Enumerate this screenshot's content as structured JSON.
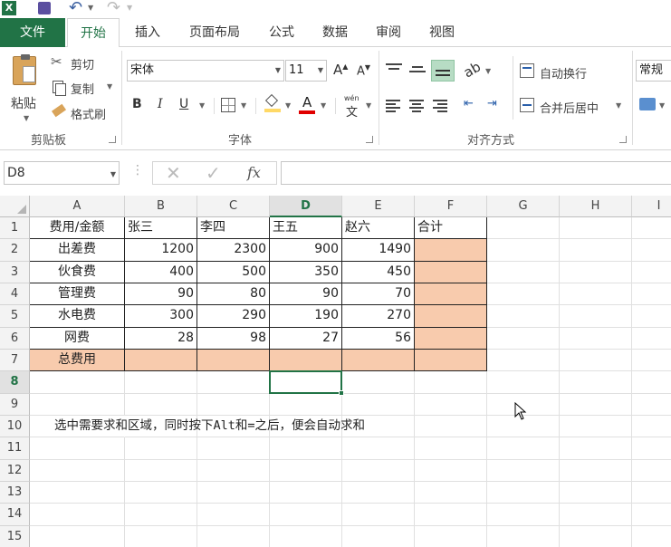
{
  "ribbon_tabs": [
    "文件",
    "开始",
    "插入",
    "页面布局",
    "公式",
    "数据",
    "审阅",
    "视图"
  ],
  "clipboard": {
    "paste": "粘贴",
    "cut": "剪切",
    "copy": "复制",
    "format_painter": "格式刷",
    "group": "剪贴板"
  },
  "font": {
    "name": "宋体",
    "size": "11",
    "group": "字体",
    "bold": "B",
    "italic": "I",
    "underline": "U",
    "font_color_glyph": "A",
    "phonetic": "wén"
  },
  "alignment": {
    "wrap_text": "自动换行",
    "merge_center": "合并后居中",
    "group": "对齐方式"
  },
  "number": {
    "format": "常规"
  },
  "formula_bar": {
    "name_box": "D8",
    "fx": "fx",
    "content": ""
  },
  "columns": [
    "A",
    "B",
    "C",
    "D",
    "E",
    "F",
    "G",
    "H",
    "I"
  ],
  "rows": [
    "1",
    "2",
    "3",
    "4",
    "5",
    "6",
    "7",
    "8",
    "9",
    "10",
    "11",
    "12",
    "13",
    "14",
    "15"
  ],
  "sheet": {
    "headers": [
      "费用/金额",
      "张三",
      "李四",
      "王五",
      "赵六",
      "合计"
    ],
    "data": [
      [
        "出差费",
        "1200",
        "2300",
        "900",
        "1490",
        ""
      ],
      [
        "伙食费",
        "400",
        "500",
        "350",
        "450",
        ""
      ],
      [
        "管理费",
        "90",
        "80",
        "90",
        "70",
        ""
      ],
      [
        "水电费",
        "300",
        "290",
        "190",
        "270",
        ""
      ],
      [
        "网费",
        "28",
        "98",
        "27",
        "56",
        ""
      ]
    ],
    "total_label": "总费用",
    "note": "选中需要求和区域，同时按下Alt和=之后，便会自动求和"
  },
  "colors": {
    "accent": "#217346",
    "fill": "#f8cbad"
  }
}
